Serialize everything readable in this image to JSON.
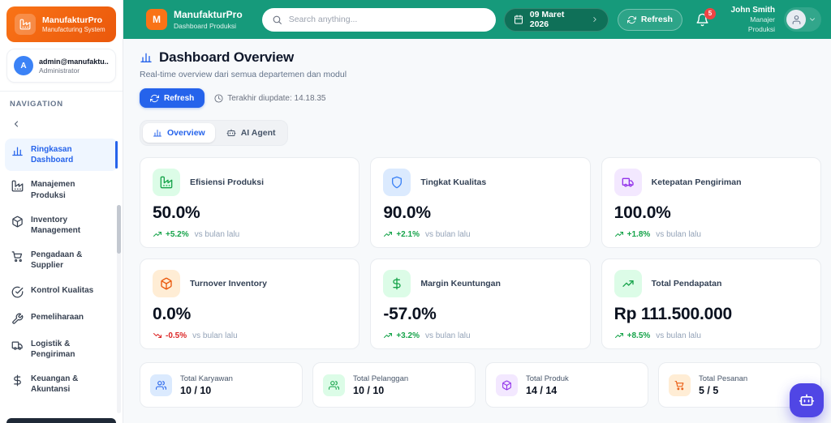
{
  "theme": {
    "header_green": "#169a7b",
    "logo_orange": "#f97316",
    "accent_blue": "#2563eb",
    "fab_indigo": "#5046e5",
    "trend_up": "#16a34a",
    "trend_down": "#dc2626"
  },
  "sidebar": {
    "logo": {
      "icon": "factory-icon",
      "title": "ManufakturPro",
      "subtitle": "Manufacturing System"
    },
    "user": {
      "initial": "A",
      "email": "admin@manufaktu...",
      "role": "Administrator"
    },
    "nav_label": "NAVIGATION",
    "items": [
      {
        "label": "Ringkasan Dashboard",
        "icon": "bar-chart-icon",
        "active": true
      },
      {
        "label": "Manajemen Produksi",
        "icon": "factory-icon",
        "active": false
      },
      {
        "label": "Inventory Management",
        "icon": "box-icon",
        "active": false
      },
      {
        "label": "Pengadaan & Supplier",
        "icon": "cart-icon",
        "active": false
      },
      {
        "label": "Kontrol Kualitas",
        "icon": "check-circle-icon",
        "active": false
      },
      {
        "label": "Pemeliharaan",
        "icon": "wrench-icon",
        "active": false
      },
      {
        "label": "Logistik & Pengiriman",
        "icon": "truck-icon",
        "active": false
      },
      {
        "label": "Keuangan & Akuntansi",
        "icon": "dollar-icon",
        "active": false
      }
    ]
  },
  "header": {
    "brand": {
      "initial": "M",
      "title": "ManufakturPro",
      "subtitle": "Dashboard Produksi"
    },
    "search_placeholder": "Search anything...",
    "date": "09 Maret 2026",
    "refresh_label": "Refresh",
    "notifications_count": "5",
    "user": {
      "name": "John Smith",
      "role": "Manajer Produksi"
    }
  },
  "main": {
    "title": "Dashboard Overview",
    "subtitle": "Real-time overview dari semua departemen dan modul",
    "refresh_label": "Refresh",
    "last_updated": "Terakhir diupdate: 14.18.35",
    "tabs": [
      {
        "label": "Overview",
        "icon": "bar-chart-icon",
        "active": true
      },
      {
        "label": "AI Agent",
        "icon": "robot-icon",
        "active": false
      }
    ],
    "kpi_cards": [
      {
        "label": "Efisiensi Produksi",
        "value": "50.0%",
        "icon": "factory-icon",
        "icon_color": "#16a34a",
        "icon_bg": "#dcfce7",
        "trend": "+5.2%",
        "trend_dir": "up",
        "trend_note": "vs bulan lalu"
      },
      {
        "label": "Tingkat Kualitas",
        "value": "90.0%",
        "icon": "shield-icon",
        "icon_color": "#3b82f6",
        "icon_bg": "#dbeafe",
        "trend": "+2.1%",
        "trend_dir": "up",
        "trend_note": "vs bulan lalu"
      },
      {
        "label": "Ketepatan Pengiriman",
        "value": "100.0%",
        "icon": "truck-icon",
        "icon_color": "#9333ea",
        "icon_bg": "#f3e8ff",
        "trend": "+1.8%",
        "trend_dir": "up",
        "trend_note": "vs bulan lalu"
      },
      {
        "label": "Turnover Inventory",
        "value": "0.0%",
        "icon": "box-icon",
        "icon_color": "#ea580c",
        "icon_bg": "#ffedd5",
        "trend": "-0.5%",
        "trend_dir": "down",
        "trend_note": "vs bulan lalu"
      },
      {
        "label": "Margin Keuntungan",
        "value": "-57.0%",
        "icon": "dollar-icon",
        "icon_color": "#16a34a",
        "icon_bg": "#dcfce7",
        "trend": "+3.2%",
        "trend_dir": "up",
        "trend_note": "vs bulan lalu"
      },
      {
        "label": "Total Pendapatan",
        "value": "Rp 111.500.000",
        "icon": "trending-up-icon",
        "icon_color": "#16a34a",
        "icon_bg": "#dcfce7",
        "trend": "+8.5%",
        "trend_dir": "up",
        "trend_note": "vs bulan lalu"
      }
    ],
    "stat_cards": [
      {
        "label": "Total Karyawan",
        "value": "10 / 10",
        "icon": "users-icon",
        "icon_color": "#2563eb",
        "icon_bg": "#dbeafe"
      },
      {
        "label": "Total Pelanggan",
        "value": "10 / 10",
        "icon": "users-icon",
        "icon_color": "#16a34a",
        "icon_bg": "#dcfce7"
      },
      {
        "label": "Total Produk",
        "value": "14 / 14",
        "icon": "box-icon",
        "icon_color": "#9333ea",
        "icon_bg": "#f3e8ff"
      },
      {
        "label": "Total Pesanan",
        "value": "5 / 5",
        "icon": "cart-icon",
        "icon_color": "#ea580c",
        "icon_bg": "#ffedd5"
      }
    ]
  },
  "fab": {
    "icon": "robot-icon"
  }
}
